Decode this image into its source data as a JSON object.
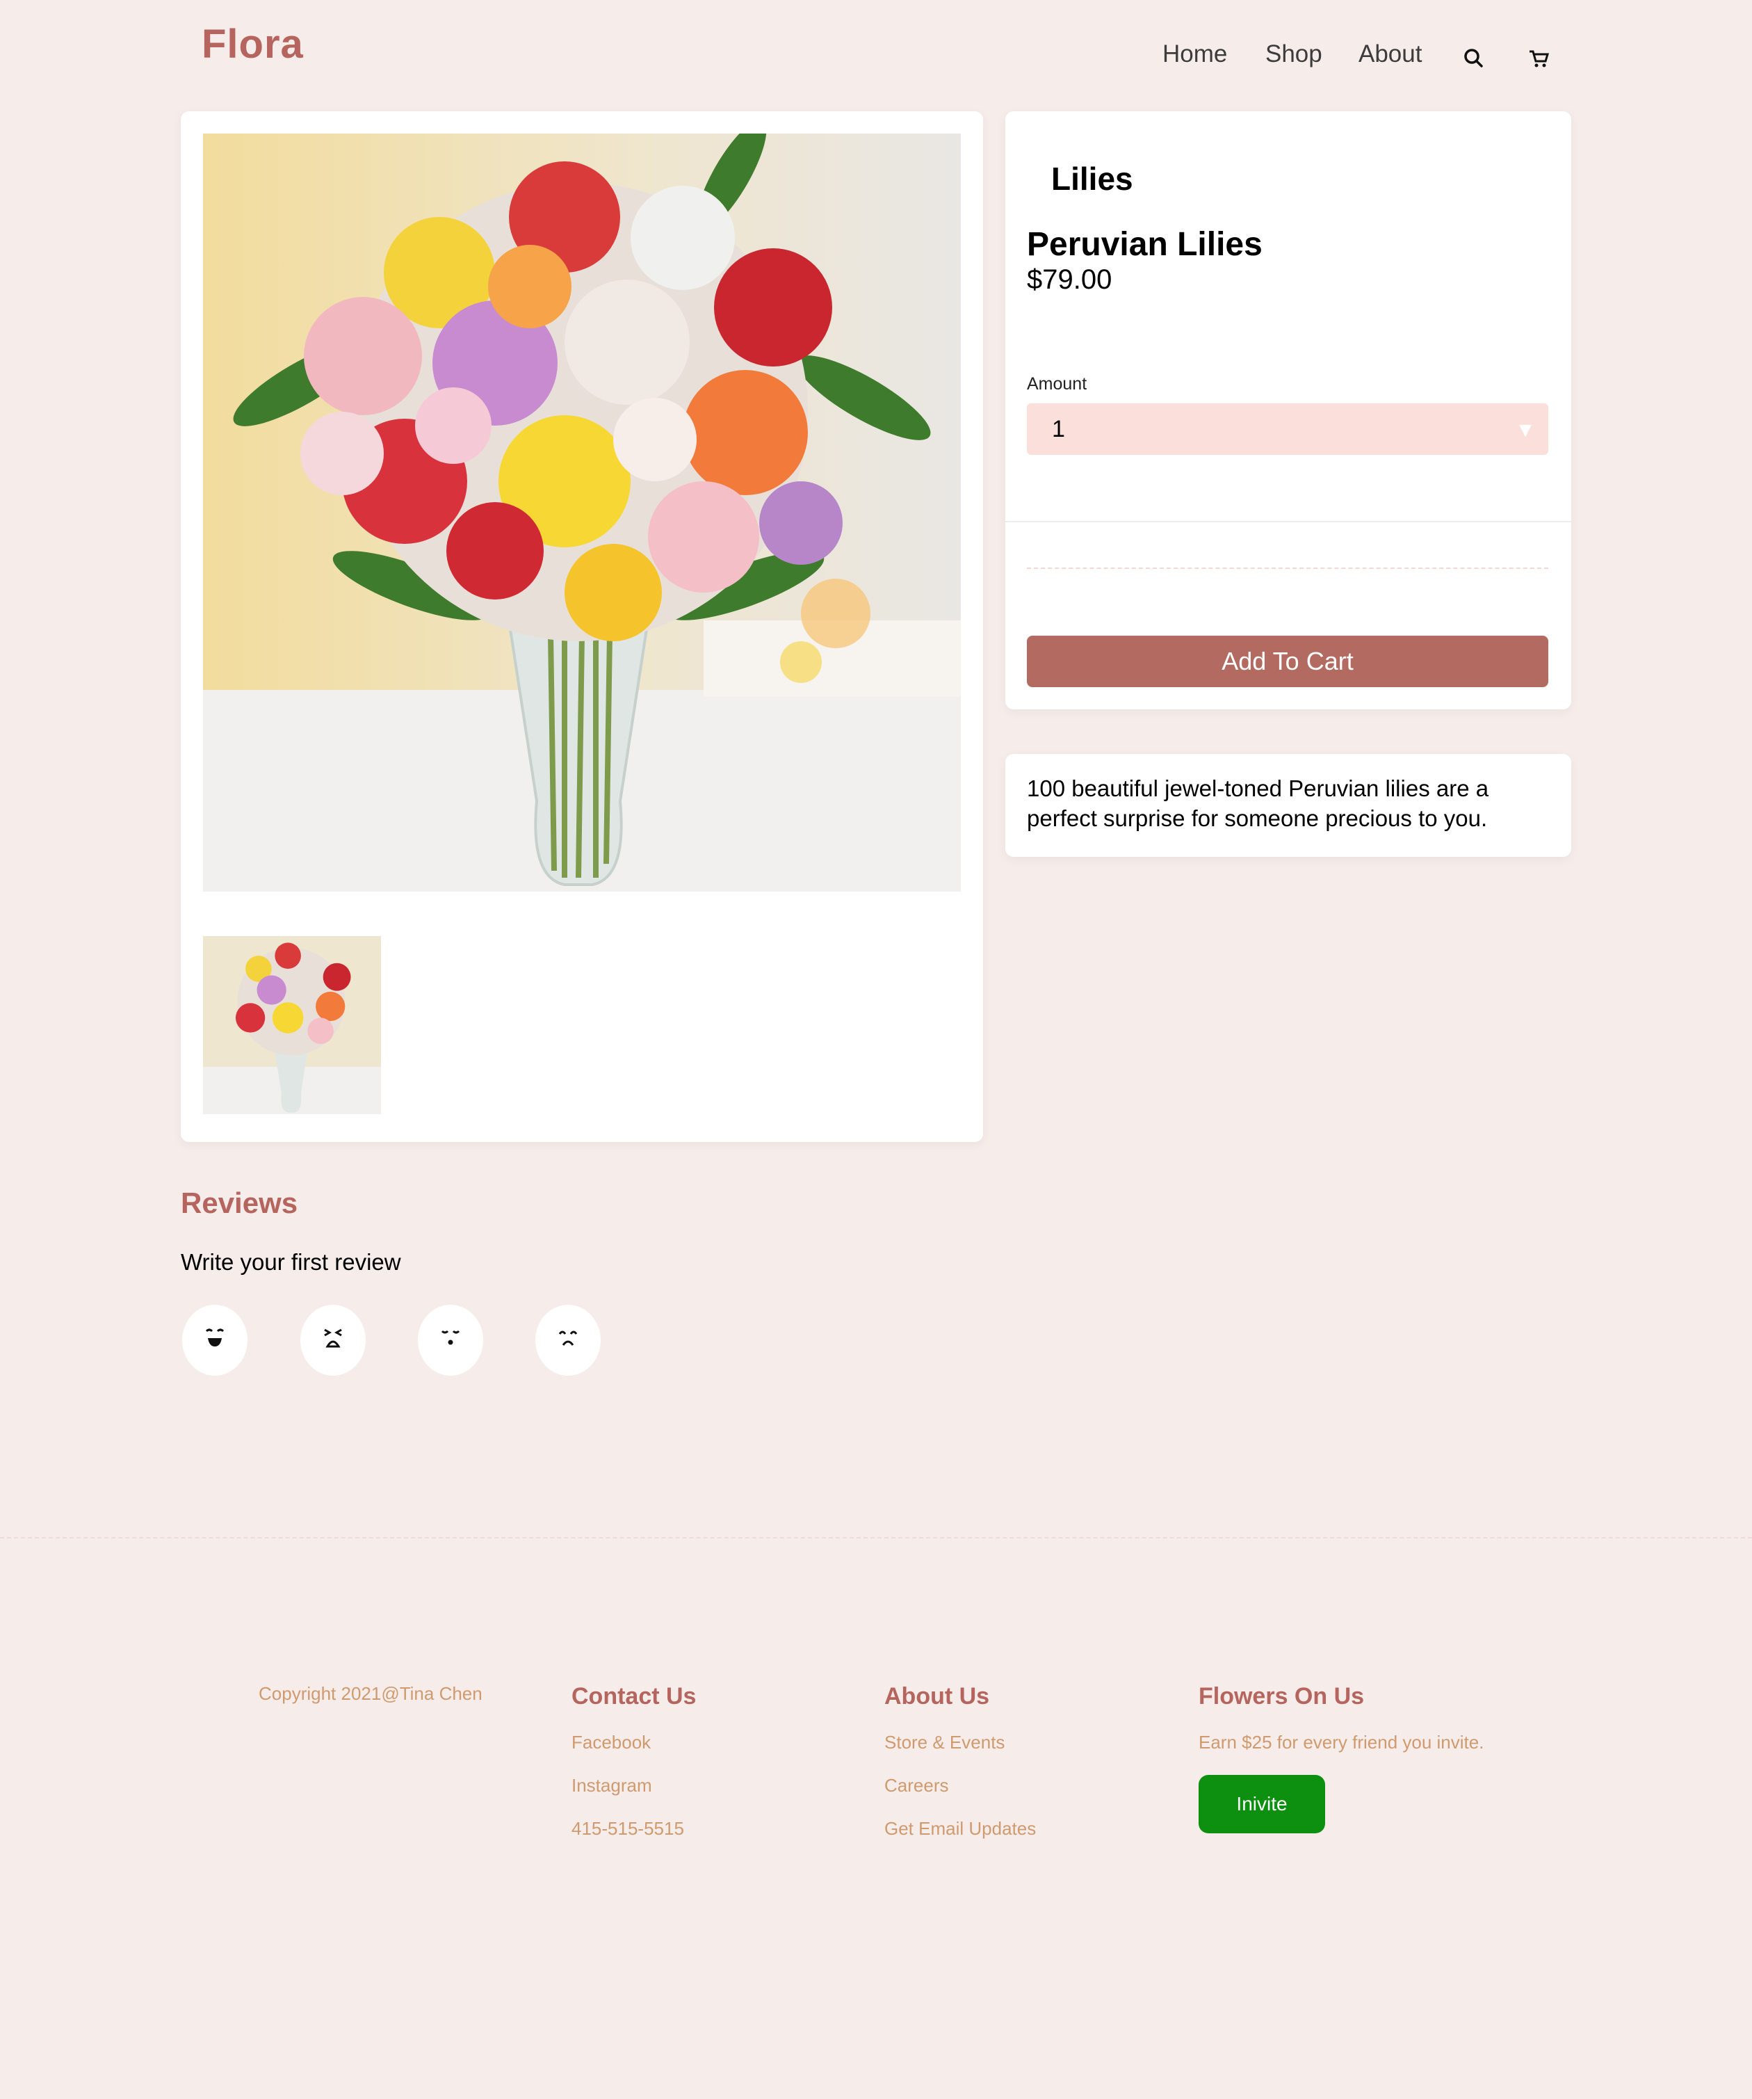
{
  "header": {
    "logo": "Flora",
    "nav": [
      "Home",
      "Shop",
      "About"
    ],
    "icons": [
      "search-icon",
      "cart-icon"
    ]
  },
  "product": {
    "category": "Lilies",
    "name": "Peruvian Lilies",
    "price": "$79.00",
    "amount_label": "Amount",
    "amount_value": "1",
    "add_to_cart": "Add To Cart",
    "description": "100 beautiful jewel-toned Peruvian lilies are a perfect surprise for someone precious to you."
  },
  "reviews": {
    "title": "Reviews",
    "subtitle": "Write your first review",
    "icons": [
      "grinning-face-icon",
      "laughing-face-icon",
      "neutral-face-icon",
      "sad-face-icon"
    ]
  },
  "footer": {
    "copyright": "Copyright 2021@Tina Chen",
    "columns": [
      {
        "title": "Contact Us",
        "links": [
          "Facebook",
          "Instagram",
          "415-515-5515"
        ]
      },
      {
        "title": "About Us",
        "links": [
          "Store & Events",
          "Careers",
          "Get Email Updates"
        ]
      },
      {
        "title": "Flowers On Us",
        "links": [
          "Earn $25 for every friend you invite."
        ]
      }
    ],
    "invite_button": "Inivite",
    "invite_color": "#0d8f10"
  },
  "colors": {
    "background": "#f6ecea",
    "accent": "#b5655e",
    "button": "#b36a60",
    "select_bg": "#fbdfdb",
    "footer_link": "#cf9a6e"
  }
}
